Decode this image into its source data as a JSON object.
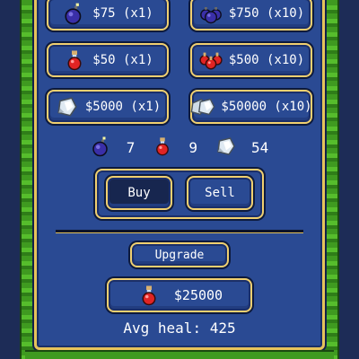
{
  "shop": {
    "bomb_x1": {
      "label": "$75 (x1)",
      "icon": "bomb-icon"
    },
    "bomb_x10": {
      "label": "$750 (x10)",
      "icon": "bomb-stack-icon"
    },
    "potion_x1": {
      "label": "$50 (x1)",
      "icon": "potion-icon"
    },
    "potion_x10": {
      "label": "$500 (x10)",
      "icon": "potion-stack-icon"
    },
    "crystal_x1": {
      "label": "$5000 (x1)",
      "icon": "crystal-icon"
    },
    "crystal_x10": {
      "label": "$50000 (x10)",
      "icon": "crystal-stack-icon"
    }
  },
  "inventory": {
    "bombs": "7",
    "potions": "9",
    "crystals": "54"
  },
  "trade": {
    "buy_label": "Buy",
    "sell_label": "Sell",
    "selected": "buy"
  },
  "upgrade": {
    "label": "Upgrade",
    "price_label": "$25000",
    "avg_heal": "Avg heal: 425"
  },
  "colors": {
    "panel": "#2a4a93",
    "border_gold": "#e6c35a",
    "grass": "#3f9a20",
    "selected_button": "#17264f"
  }
}
